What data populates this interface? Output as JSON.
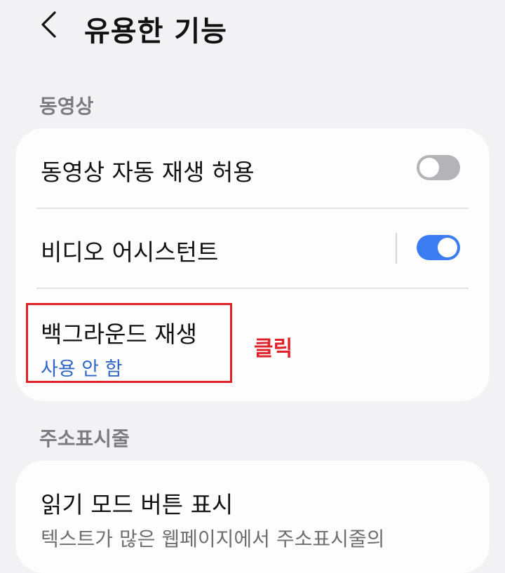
{
  "header": {
    "back_icon": "chevron-left-icon",
    "title": "유용한 기능"
  },
  "sections": [
    {
      "label": "동영상",
      "items": [
        {
          "title": "동영상 자동 재생 허용",
          "toggle": "off"
        },
        {
          "title": "비디오 어시스턴트",
          "toggle": "on"
        },
        {
          "title": "백그라운드 재생",
          "subtitle": "사용 안 함"
        }
      ]
    },
    {
      "label": "주소표시줄",
      "items": [
        {
          "title": "읽기 모드 버튼 표시",
          "subtitle_partial": "텍스트가 많은 웹페이지에서 주소표시줄의"
        }
      ]
    }
  ],
  "annotation": {
    "text": "클릭",
    "color": "#e0222a"
  },
  "colors": {
    "background": "#f2f2f4",
    "card": "#fdfdfd",
    "toggle_on": "#3b7cf0",
    "toggle_off": "#b4b4b8",
    "accent_text": "#2f66c7"
  }
}
